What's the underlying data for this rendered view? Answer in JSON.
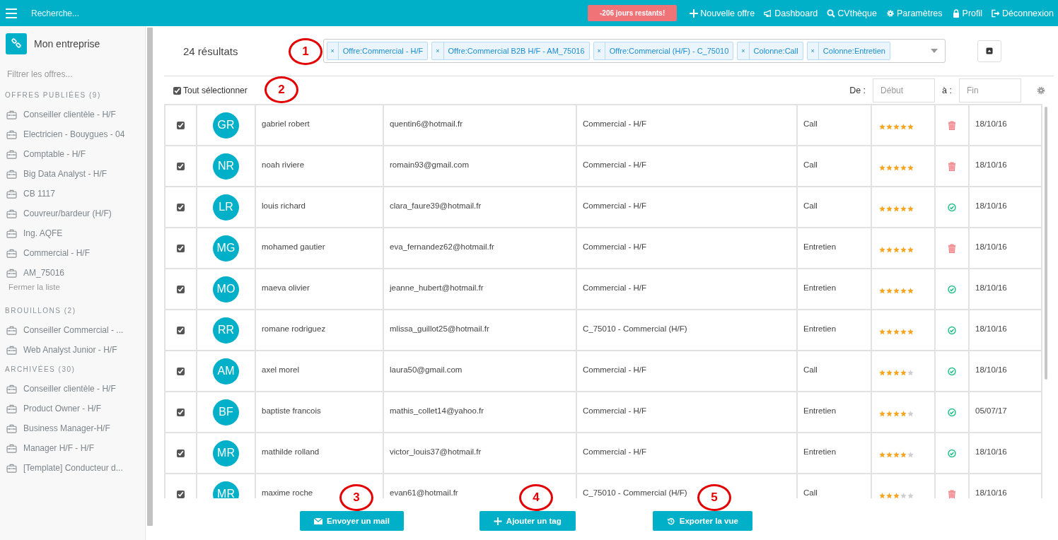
{
  "topbar": {
    "search_placeholder": "Recherche...",
    "trial_badge": "-206 jours restants!",
    "nav": [
      {
        "kind": "plus",
        "label": "Nouvelle offre"
      },
      {
        "kind": "megaphone",
        "label": "Dashboard"
      },
      {
        "kind": "search",
        "label": "CVthèque"
      },
      {
        "kind": "gear",
        "label": "Paramètres"
      },
      {
        "kind": "lock",
        "label": "Profil"
      },
      {
        "kind": "logout",
        "label": "Déconnexion"
      }
    ]
  },
  "sidebar": {
    "company": "Mon entreprise",
    "filter_placeholder": "Filtrer les offres...",
    "sections": [
      {
        "title": "OFFRES PUBLIÉES (9)",
        "items": [
          "Conseiller clientèle - H/F",
          "Electricien - Bouygues - 04",
          "Comptable - H/F",
          "Big Data Analyst - H/F",
          "CB 1117",
          "Couvreur/bardeur (H/F)",
          "Ing. AQFE",
          "Commercial - H/F",
          "AM_75016"
        ],
        "footer_link": "Fermer la liste"
      },
      {
        "title": "BROUILLONS (2)",
        "items": [
          "Conseiller Commercial - ...",
          "Web Analyst Junior - H/F"
        ]
      },
      {
        "title": "ARCHIVÉES (30)",
        "items": [
          "Conseiller clientèle - H/F",
          "Product Owner - H/F",
          "Business Manager-H/F",
          "Manager H/F - H/F",
          "[Template] Conducteur d..."
        ]
      }
    ]
  },
  "results": {
    "count": "24 résultats",
    "filters": [
      "Offre:Commercial - H/F",
      "Offre:Commercial B2B H/F - AM_75016",
      "Offre:Commercial (H/F) - C_75010",
      "Colonne:Call",
      "Colonne:Entretien"
    ],
    "tag_remove": "×"
  },
  "toolbar": {
    "select_all": {
      "label": "Tout sélectionner",
      "checked": true
    },
    "from_label": "De :",
    "from_placeholder": "Début",
    "to_label": "à :",
    "to_placeholder": "Fin"
  },
  "rows": [
    {
      "checked": true,
      "initials": "GR",
      "name": "gabriel robert",
      "email": "quentin6@hotmail.fr",
      "offer": "Commercial - H/F",
      "column": "Call",
      "stars": 5,
      "rejected": true,
      "date": "18/10/16"
    },
    {
      "checked": true,
      "initials": "NR",
      "name": "noah riviere",
      "email": "romain93@gmail.com",
      "offer": "Commercial - H/F",
      "column": "Call",
      "stars": 5,
      "rejected": true,
      "date": "18/10/16"
    },
    {
      "checked": true,
      "initials": "LR",
      "name": "louis richard",
      "email": "clara_faure39@hotmail.fr",
      "offer": "Commercial - H/F",
      "column": "Call",
      "stars": 5,
      "rejected": false,
      "date": "18/10/16"
    },
    {
      "checked": true,
      "initials": "MG",
      "name": "mohamed gautier",
      "email": "eva_fernandez62@hotmail.fr",
      "offer": "Commercial - H/F",
      "column": "Entretien",
      "stars": 5,
      "rejected": true,
      "date": "18/10/16"
    },
    {
      "checked": true,
      "initials": "MO",
      "name": "maeva olivier",
      "email": "jeanne_hubert@hotmail.fr",
      "offer": "Commercial - H/F",
      "column": "Entretien",
      "stars": 5,
      "rejected": false,
      "date": "18/10/16"
    },
    {
      "checked": true,
      "initials": "RR",
      "name": "romane rodriguez",
      "email": "mlissa_guillot25@hotmail.fr",
      "offer": "C_75010 - Commercial (H/F)",
      "column": "Entretien",
      "stars": 5,
      "rejected": false,
      "date": "18/10/16"
    },
    {
      "checked": true,
      "initials": "AM",
      "name": "axel morel",
      "email": "laura50@gmail.com",
      "offer": "Commercial - H/F",
      "column": "Call",
      "stars": 4,
      "rejected": false,
      "date": "18/10/16"
    },
    {
      "checked": true,
      "initials": "BF",
      "name": "baptiste francois",
      "email": "mathis_collet14@yahoo.fr",
      "offer": "Commercial - H/F",
      "column": "Entretien",
      "stars": 4,
      "rejected": false,
      "date": "05/07/17"
    },
    {
      "checked": true,
      "initials": "MR",
      "name": "mathilde rolland",
      "email": "victor_louis37@hotmail.fr",
      "offer": "Commercial - H/F",
      "column": "Entretien",
      "stars": 4,
      "rejected": false,
      "date": "18/10/16"
    },
    {
      "checked": true,
      "initials": "MR",
      "name": "maxime roche",
      "email": "evan61@hotmail.fr",
      "offer": "C_75010 - Commercial (H/F)",
      "column": "Call",
      "stars": 3,
      "rejected": true,
      "date": "18/10/16"
    }
  ],
  "actions": [
    {
      "kind": "mail",
      "label": "Envoyer un mail"
    },
    {
      "kind": "plus",
      "label": "Ajouter un tag"
    },
    {
      "kind": "history",
      "label": "Exporter la vue"
    }
  ],
  "annotations": [
    "1",
    "2",
    "3",
    "4",
    "5"
  ]
}
